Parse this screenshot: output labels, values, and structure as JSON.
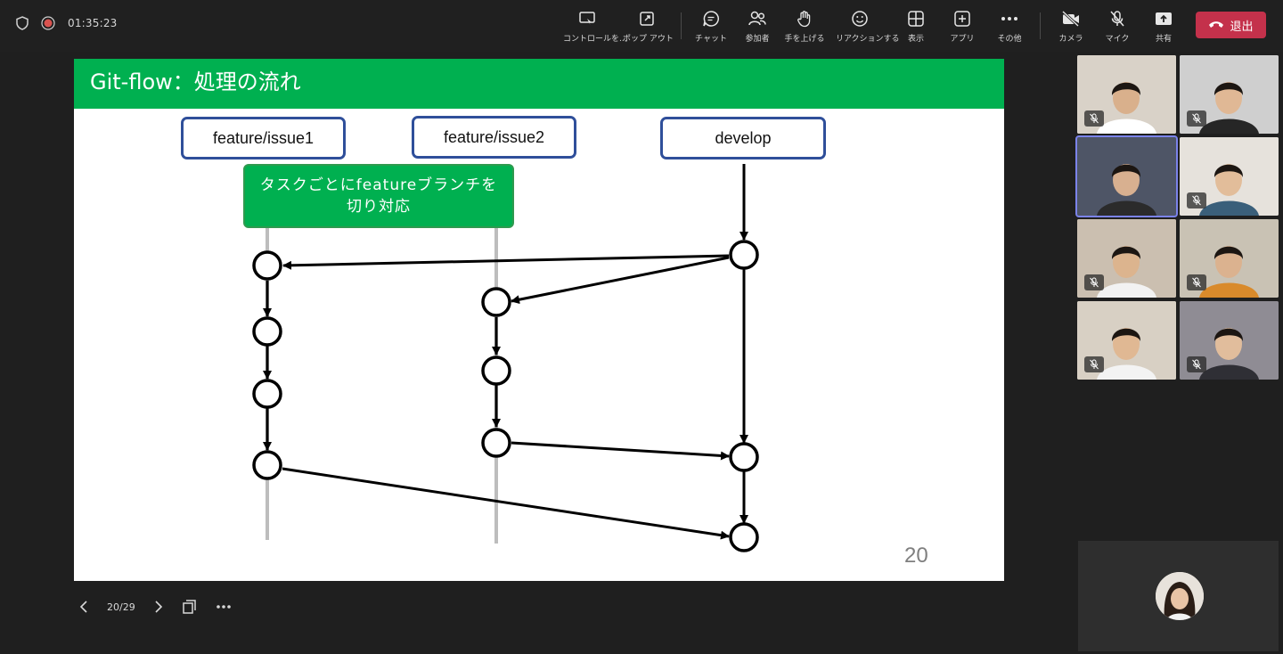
{
  "meeting": {
    "timer": "01:35:23"
  },
  "toolbar": {
    "items": [
      {
        "label": "コントロールを...",
        "icon": "share-control-icon"
      },
      {
        "label": "ポップ アウト",
        "icon": "popout-icon"
      },
      {
        "label": "チャット",
        "icon": "chat-icon"
      },
      {
        "label": "参加者",
        "icon": "people-icon"
      },
      {
        "label": "手を上げる",
        "icon": "raise-hand-icon"
      },
      {
        "label": "リアクションする",
        "icon": "reaction-icon"
      },
      {
        "label": "表示",
        "icon": "view-icon"
      },
      {
        "label": "アプリ",
        "icon": "apps-icon"
      },
      {
        "label": "その他",
        "icon": "more-icon"
      },
      {
        "label": "カメラ",
        "icon": "camera-icon"
      },
      {
        "label": "マイク",
        "icon": "mic-off-icon"
      },
      {
        "label": "共有",
        "icon": "share-icon"
      }
    ],
    "leave_label": "退出",
    "leave_color": "#c4314b"
  },
  "slide": {
    "title": "Git-flow：処理の流れ",
    "title_color": "#00b050",
    "branches": [
      "feature/issue1",
      "feature/issue2",
      "develop"
    ],
    "note_line1": "タスクごとにfeatureブランチを",
    "note_line2": "切り対応",
    "page_number": "20"
  },
  "presenter": {
    "page_counter": "20/29"
  },
  "participants": {
    "count": 8,
    "selected_index": 2
  }
}
